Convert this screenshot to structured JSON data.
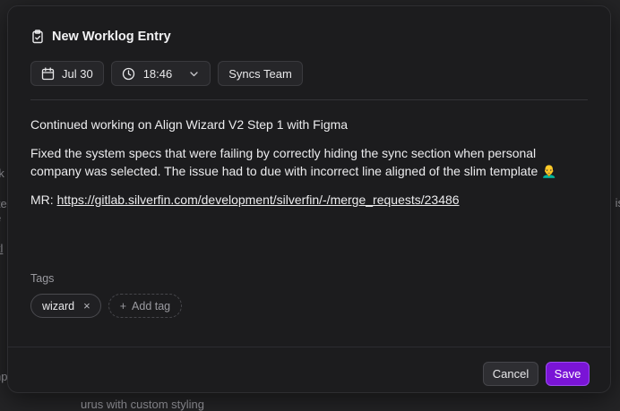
{
  "background": {
    "fragments": [
      "rk",
      "ite",
      "e",
      "itl",
      "np",
      "urus with custom styling",
      "is"
    ]
  },
  "modal": {
    "title": "New Worklog Entry",
    "icons": {
      "title": "clipboard-icon",
      "date": "calendar-icon",
      "time": "clock-icon",
      "time_toggle": "chevron-down-icon"
    },
    "date_label": "Jul 30",
    "time_label": "18:46",
    "team_label": "Syncs Team",
    "body": {
      "line1": "Continued working on Align Wizard V2 Step 1 with Figma",
      "line2": "Fixed the system specs that were failing by correctly hiding the sync section when personal company was selected. The issue had to due with incorrect line aligned of the slim template 👨‍🦲",
      "mr_prefix": "MR: ",
      "mr_link": "https://gitlab.silverfin.com/development/silverfin/-/merge_requests/23486"
    },
    "tags_label": "Tags",
    "tags": [
      {
        "label": "wizard",
        "remove_symbol": "×"
      }
    ],
    "add_tag_symbol": "+",
    "add_tag_label": "Add tag",
    "cancel_label": "Cancel",
    "save_label": "Save",
    "accent_color": "#7a14d6"
  }
}
